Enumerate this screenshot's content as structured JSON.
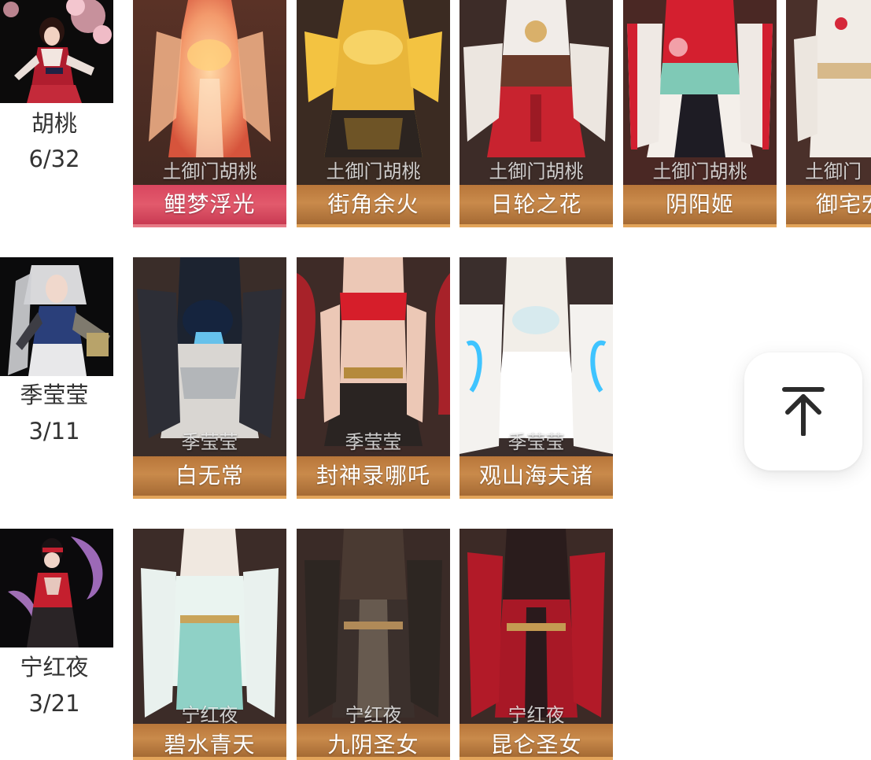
{
  "characters": [
    {
      "name": "胡桃",
      "count": "6/32",
      "skins": [
        {
          "owner": "土御门胡桃",
          "name": "鲤梦浮光",
          "bar": "red"
        },
        {
          "owner": "土御门胡桃",
          "name": "街角余火",
          "bar": "gold"
        },
        {
          "owner": "土御门胡桃",
          "name": "日轮之花",
          "bar": "gold"
        },
        {
          "owner": "土御门胡桃",
          "name": "阴阳姬",
          "bar": "gold"
        },
        {
          "owner": "土御门",
          "name": "御宅宏",
          "bar": "gold"
        }
      ]
    },
    {
      "name": "季莹莹",
      "count": "3/11",
      "skins": [
        {
          "owner": "季莹莹",
          "name": "白无常",
          "bar": "gold"
        },
        {
          "owner": "季莹莹",
          "name": "封神录哪吒",
          "bar": "gold"
        },
        {
          "owner": "季莹莹",
          "name": "观山海夫诸",
          "bar": "gold"
        }
      ]
    },
    {
      "name": "宁红夜",
      "count": "3/21",
      "skins": [
        {
          "owner": "宁红夜",
          "name": "碧水青天",
          "bar": "gold"
        },
        {
          "owner": "宁红夜",
          "name": "九阴圣女",
          "bar": "gold"
        },
        {
          "owner": "宁红夜",
          "name": "昆仑圣女",
          "bar": "gold"
        }
      ]
    }
  ],
  "back_to_top": {
    "icon": "arrow-up-to-line-icon"
  },
  "colors": {
    "text": "#333333",
    "gold_bar": "#c98a4b",
    "red_bar": "#e25a6c",
    "background": "#ffffff"
  }
}
